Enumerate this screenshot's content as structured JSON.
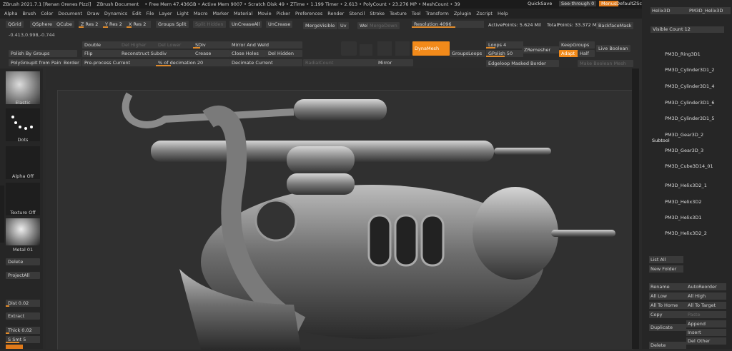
{
  "title_bar": {
    "app": "ZBrush 2021.7.1 [Renan Orenes Pizzi]",
    "document": "ZBrush Document",
    "stats": "• Free Mem 47.436GB • Active Mem 9007 • Scratch Disk 49 • ZTime • 1.199 Timer • 2.613 • PolyCount • 23.276 MP • MeshCount • 39",
    "quicksave": "QuickSave",
    "see_through": "See-through  0",
    "menus": "Menus",
    "default_script": "DefaultZScript"
  },
  "menu_bar": {
    "items": [
      "Alpha",
      "Brush",
      "Color",
      "Document",
      "Draw",
      "Dynamics",
      "Edit",
      "File",
      "Layer",
      "Light",
      "Macro",
      "Marker",
      "Material",
      "Movie",
      "Picker",
      "Preferences",
      "Render",
      "Stencil",
      "Stroke",
      "Texture",
      "Tool",
      "Transform",
      "Zplugin",
      "Zscript",
      "Help"
    ]
  },
  "toolbar": {
    "row1": {
      "qgrid": "QGrid",
      "qsphere": "QSphere",
      "qcube": "QCube",
      "zres": "Z Res 2",
      "yres": "Y Res 2",
      "xres": "X Res 2",
      "groups_split": "Groups Split",
      "split_hidden": "Split Hidden",
      "uncreaseall": "UnCreaseAll",
      "uncrease": "UnCrease",
      "mergevisible": "MergeVisible",
      "uv": "Uv",
      "weld": "Weld",
      "mergedown": "MergeDown",
      "resolution": "Resolution 4096",
      "activepoints": "ActivePoints: 5.624 Mil",
      "totalpoints": "TotalPoints: 33.372 Mil",
      "backfacemask": "BackfaceMask"
    },
    "coords": "-0.413,0.998,-0.744",
    "row2": {
      "double": "Double",
      "del_higher": "Del Higher",
      "sdiv": "SDiv",
      "mirror_weld": "Mirror And Weld",
      "flip": "Flip",
      "preprocess": "Pre-process Current",
      "reconstruct": "Reconstruct Subdiv",
      "crease": "Crease",
      "close_holes": "Close Holes",
      "del_hidden": "Del Hidden",
      "decimation": "% of decimation 20",
      "decimate": "Decimate Current",
      "radialcount": "RadialCount",
      "mirror": "Mirror",
      "del_lower": "Del Lower"
    },
    "polish": {
      "polish_groups": "Polish By Groups",
      "polygroupit": "PolyGroupIt from Paint",
      "border": "Border"
    },
    "icons": {
      "dynamesh": "DynaMesh",
      "groupsloops": "GroupsLoops",
      "loops": "Loops 4",
      "gpolish": "GPolish 50",
      "zremesher": "ZRemesher",
      "keepgroups": "KeepGroups",
      "adapt": "Adapt",
      "half": "Half",
      "live_boolean": "Live Boolean",
      "edgeloop": "Edgeloop Masked Border",
      "make_boolean": "Make Boolean Mesh"
    }
  },
  "left_panel": {
    "elastic": "Elastic",
    "dots": "Dots",
    "alpha_off": "Alpha Off",
    "texture_off": "Texture Off",
    "metal": "Metal 01",
    "delete": "Delete",
    "project_all": "ProjectAll",
    "dist": "Dist 0.02",
    "extract": "Extract",
    "thick": "Thick 0.02",
    "s_smt": "S Smt 5"
  },
  "right_panel": {
    "top_tabs": [
      "Helix3D",
      "PM3D_Helix3D"
    ],
    "visible_count": "Visible Count 12",
    "subtool_header": "Subtool",
    "subtools": [
      "PM3D_Ring3D1",
      "PM3D_Cylinder3D1_2",
      "PM3D_Cylinder3D1_4",
      "PM3D_Cylinder3D1_6",
      "PM3D_Cylinder3D1_5",
      "PM3D_Gear3D_2",
      "PM3D_Gear3D_3",
      "PM3D_Cube3D14_01",
      "PM3D_Helix3D2_1",
      "PM3D_Helix3D2",
      "PM3D_Helix3D1",
      "PM3D_Helix3D2_2"
    ],
    "list_all": "List All",
    "new_folder": "New Folder",
    "rename": "Rename",
    "autoreorder": "AutoReorder",
    "all_low": "All Low",
    "all_high": "All High",
    "all_to_home": "All To Home",
    "all_to_target": "All To Target",
    "copy": "Copy",
    "paste": "Paste",
    "duplicate": "Duplicate",
    "append": "Append",
    "insert": "Insert",
    "delete": "Delete",
    "del_other": "Del Other"
  }
}
